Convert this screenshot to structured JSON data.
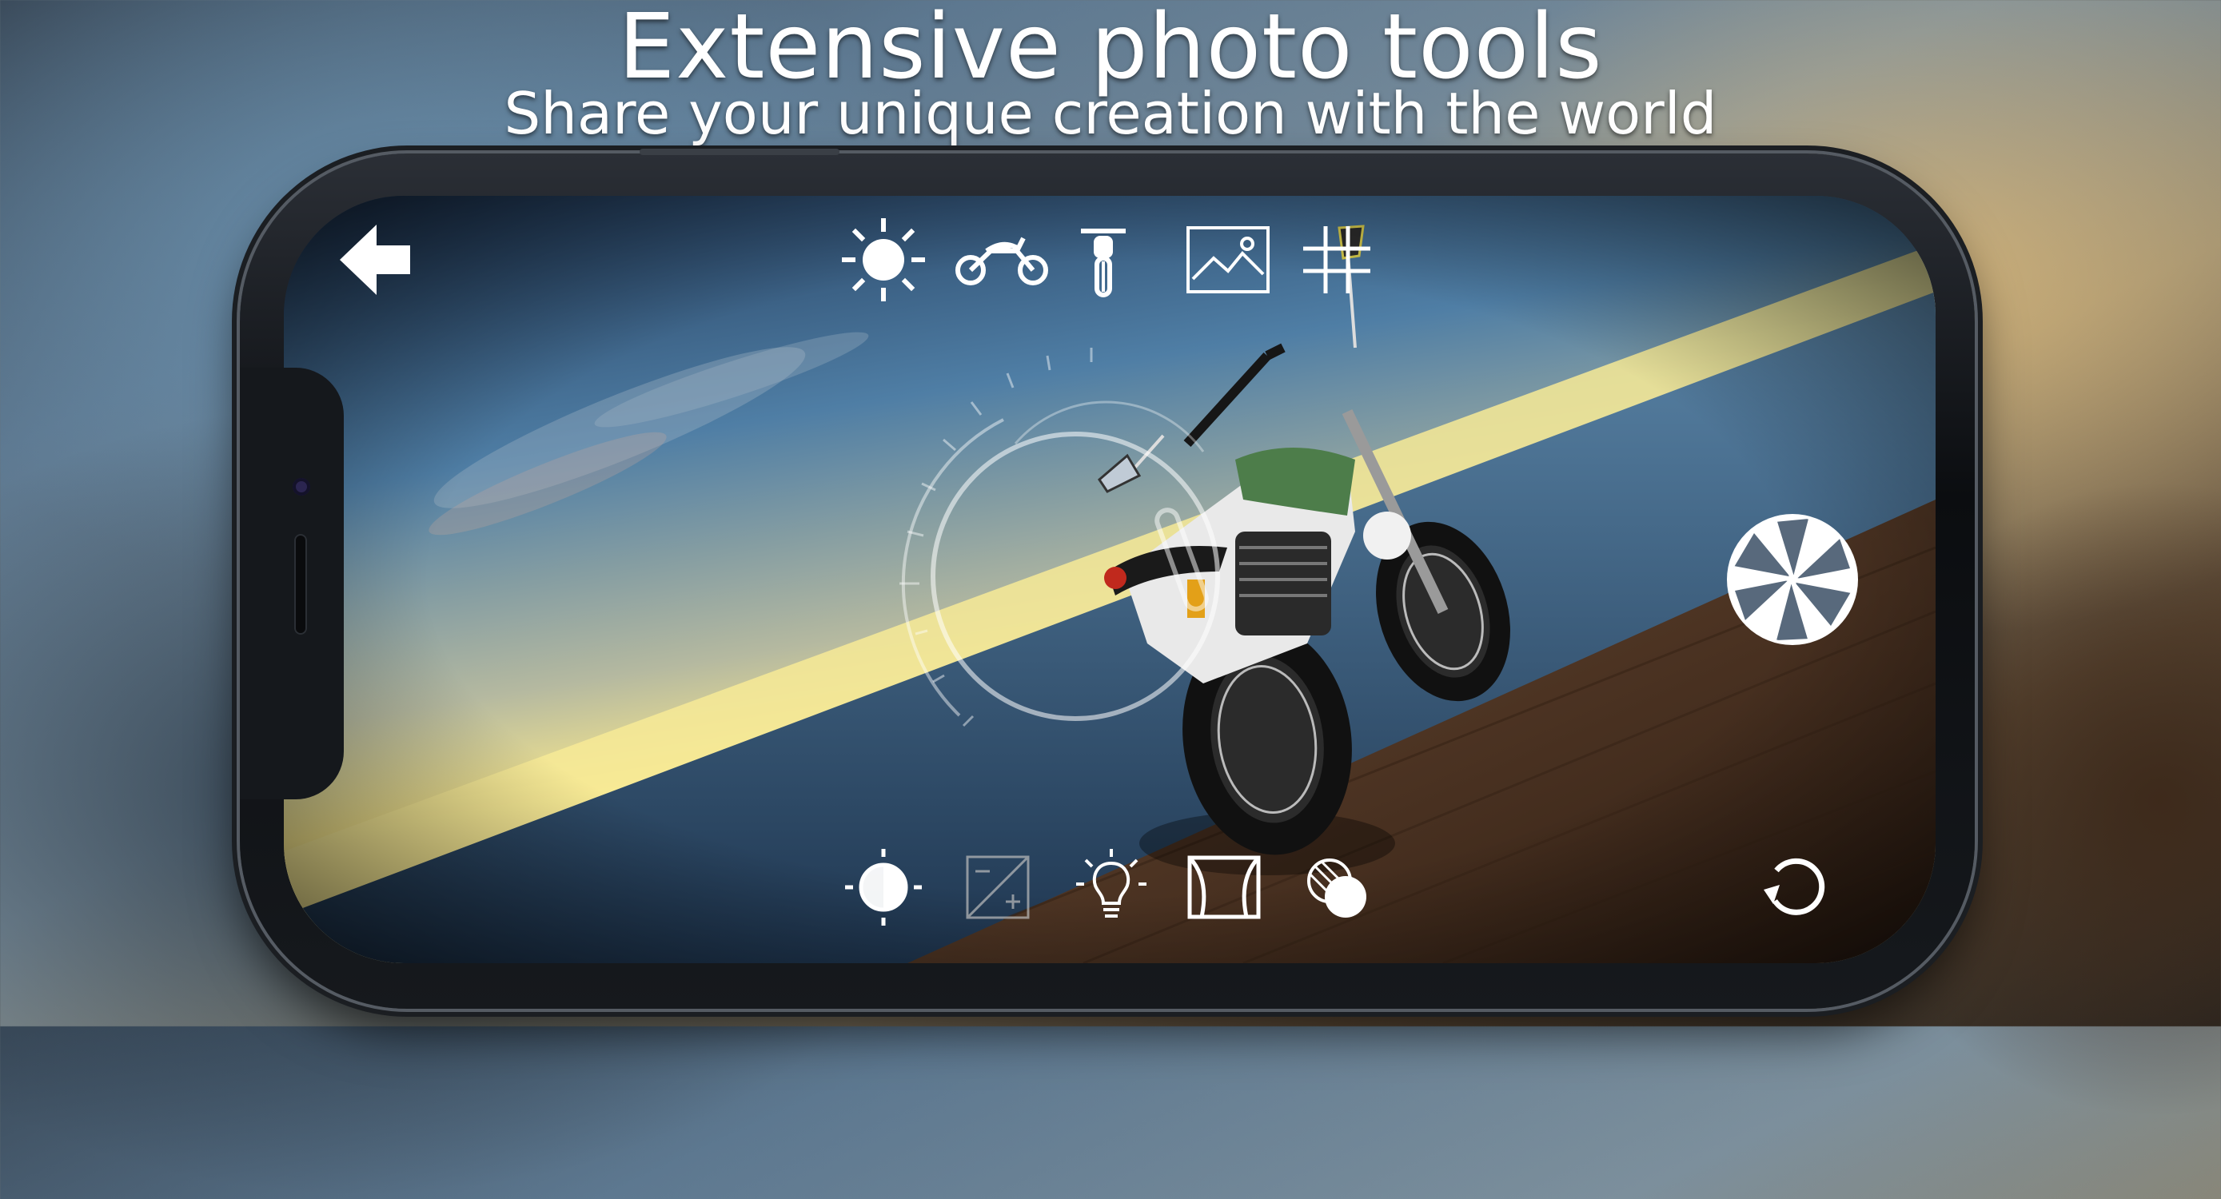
{
  "headline": {
    "title": "Extensive photo tools",
    "subtitle": "Share your unique creation with the world"
  },
  "toolbar_top": {
    "items": [
      {
        "icon": "sun-icon"
      },
      {
        "icon": "motorcycle-side-icon"
      },
      {
        "icon": "motorcycle-front-icon"
      },
      {
        "icon": "landscape-image-icon"
      },
      {
        "icon": "grid-icon"
      }
    ]
  },
  "toolbar_bottom": {
    "items": [
      {
        "icon": "contrast-icon"
      },
      {
        "icon": "exposure-icon"
      },
      {
        "icon": "lightbulb-icon"
      },
      {
        "icon": "curtain-frame-icon"
      },
      {
        "icon": "color-filter-icon"
      }
    ]
  },
  "actions": {
    "back": "back-arrow-icon",
    "shutter": "camera-shutter-icon",
    "reset": "rotate-reset-icon"
  },
  "colors": {
    "ui_white": "#ffffff",
    "sky_top": "#2d4b6e",
    "sky_horizon": "#f1e08a",
    "sea": "#3f6f95",
    "deck": "#5a3b27",
    "tank_green": "#4a7a45"
  }
}
